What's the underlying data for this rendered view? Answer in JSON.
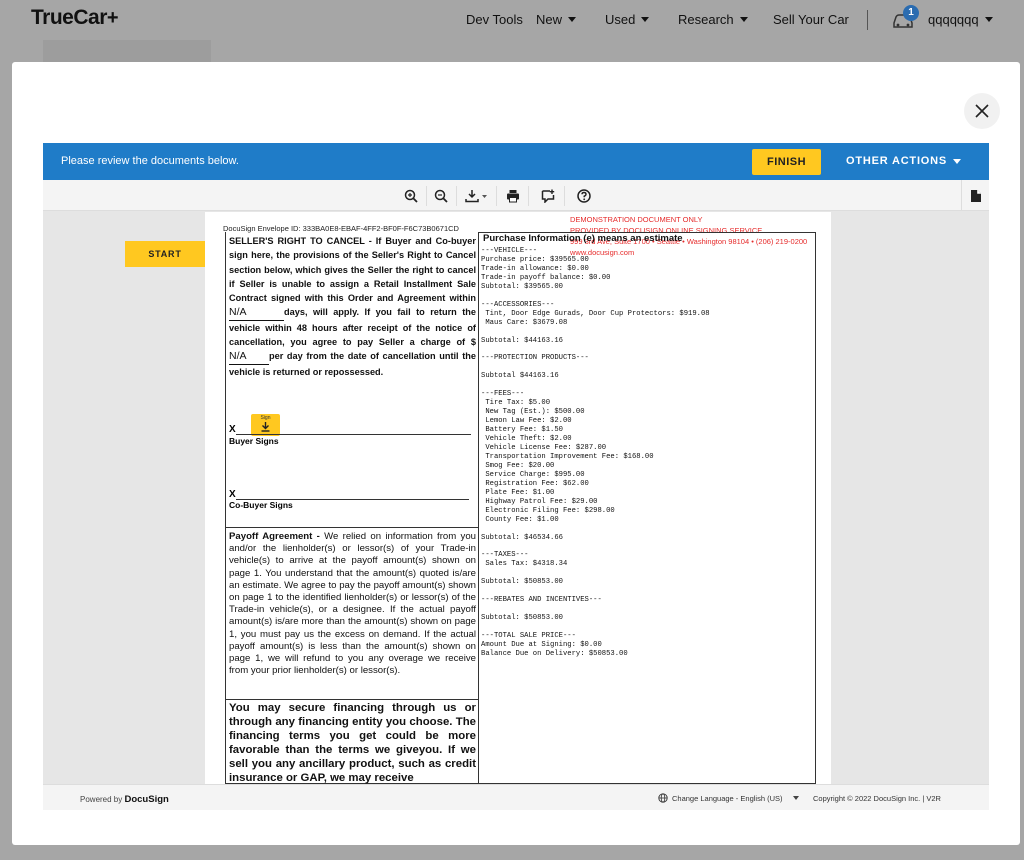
{
  "nav": {
    "logo": "TrueCar",
    "logo_plus": "+",
    "items": [
      "Dev Tools",
      "New",
      "Used",
      "Research",
      "Sell Your Car"
    ],
    "cart_count": "1",
    "user": "qqqqqqq"
  },
  "banner": {
    "message": "Please review the documents below.",
    "finish_label": "FINISH",
    "other_actions_label": "OTHER ACTIONS"
  },
  "viewer": {
    "start_label": "START",
    "envelope_id": "DocuSign Envelope ID: 333BA0E8-EBAF-4FF2-BF0F-F6C73B0671CD",
    "demo_lines": [
      "DEMONSTRATION DOCUMENT ONLY",
      "PROVIDED BY DOCUSIGN ONLINE SIGNING SERVICE",
      "999 3rd Ave, Suite 1700  •  Seattle  •  Washington 98104  •  (206) 219-0200",
      "www.docusign.com"
    ],
    "cancel_title": "SELLER'S RIGHT TO CANCEL -",
    "cancel_part1": "If Buyer and Co-buyer sign here, the provisions of the Seller's Right to Cancel section below, which gives the Seller the right to cancel if Seller is unable to assign a Retail Installment Sale Contract signed with this Order and Agreement within",
    "days_value": "N/A",
    "cancel_part2": "days, will apply. If you fail to return the vehicle within 48 hours after receipt of the notice of cancellation, you agree to pay Seller a charge of $",
    "charge_value": "N/A",
    "cancel_part3": "per day from the date of cancellation until the vehicle is returned or repossessed.",
    "sign_tag_label": "Sign",
    "sign_x": "X",
    "buyer_signs": "Buyer Signs",
    "cobuyer_x": "X",
    "cobuyer_signs": "Co-Buyer Signs",
    "payoff_title": "Payoff Agreement -",
    "payoff_text": "We relied on information from you and/or the lienholder(s) or lessor(s) of your Trade-in vehicle(s) to arrive at the payoff amount(s) shown on page 1. You understand that the amount(s) quoted is/are an estimate. We agree to pay the payoff amount(s) shown on page 1 to the identified lienholder(s) or lessor(s) of the Trade-in vehicle(s), or a designee. If the actual payoff amount(s) is/are more than the amount(s) shown on page 1, you must pay us the excess on demand. If the actual payoff amount(s) is less than the amount(s) shown on page 1, we will refund to you any overage we receive from your prior lienholder(s) or lessor(s).",
    "finance_text": "You may secure financing through us or through any financing entity you choose. The financing terms you get could be more favorable than the terms we giveyou. If we sell you any ancillary product, such as credit insurance or GAP, we may receive",
    "purchase_title": "Purchase Information (e) means an estimate",
    "purchase_lines": [
      "---VEHICLE---",
      "Purchase price: $39565.00",
      "Trade-in allowance: $0.00",
      "Trade-in payoff balance: $0.00",
      "Subtotal: $39565.00",
      "",
      "---ACCESSORIES---",
      " Tint, Door Edge Gurads, Door Cup Protectors: $919.08",
      " Maus Care: $3679.08",
      "",
      "Subtotal: $44163.16",
      "",
      "---PROTECTION PRODUCTS---",
      "",
      "Subtotal $44163.16",
      "",
      "---FEES---",
      " Tire Tax: $5.00",
      " New Tag (Est.): $500.00",
      " Lemon Law Fee: $2.00",
      " Battery Fee: $1.50",
      " Vehicle Theft: $2.00",
      " Vehicle License Fee: $287.00",
      " Transportation Improvement Fee: $168.00",
      " Smog Fee: $20.00",
      " Service Charge: $995.00",
      " Registration Fee: $62.00",
      " Plate Fee: $1.00",
      " Highway Patrol Fee: $29.00",
      " Electronic Filing Fee: $298.00",
      " County Fee: $1.00",
      "",
      "Subtotal: $46534.66",
      "",
      "---TAXES---",
      " Sales Tax: $4318.34",
      "",
      "Subtotal: $50853.00",
      "",
      "---REBATES AND INCENTIVES---",
      "",
      "Subtotal: $50853.00",
      "",
      "---TOTAL SALE PRICE---",
      "Amount Due at Signing: $0.00",
      "Balance Due on Delivery: $50853.00"
    ]
  },
  "footer": {
    "powered_by": "Powered by",
    "brand": "DocuSign",
    "language": "Change Language - English (US)",
    "copyright": "Copyright © 2022 DocuSign Inc.  |  V2R"
  },
  "colors": {
    "accent_blue": "#1f7cc8",
    "button_yellow": "#ffc820",
    "demo_red": "#e62b2b"
  }
}
